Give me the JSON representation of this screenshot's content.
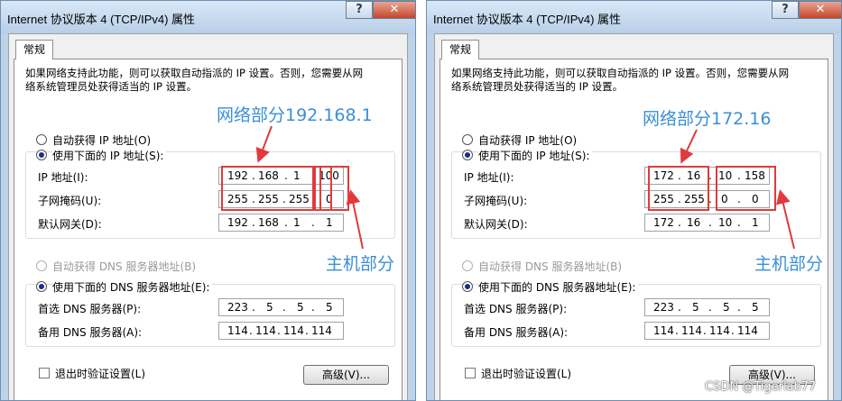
{
  "windows": [
    {
      "title": "Internet 协议版本 4 (TCP/IPv4) 属性",
      "help_label": "?",
      "close_label": "✕",
      "tab": "常规",
      "description": "如果网络支持此功能，则可以获取自动指派的 IP 设置。否则，您需要从网络系统管理员处获得适当的 IP 设置。",
      "auto_ip_label": "自动获得 IP 地址(O)",
      "manual_ip_label": "使用下面的 IP 地址(S):",
      "ip_label": "IP 地址(I):",
      "mask_label": "子网掩码(U):",
      "gateway_label": "默认网关(D):",
      "ip": [
        "192",
        "168",
        "1",
        "100"
      ],
      "mask": [
        "255",
        "255",
        "255",
        "0"
      ],
      "gateway": [
        "192",
        "168",
        "1",
        "1"
      ],
      "auto_dns_label": "自动获得 DNS 服务器地址(B)",
      "manual_dns_label": "使用下面的 DNS 服务器地址(E):",
      "dns1_label": "首选 DNS 服务器(P):",
      "dns2_label": "备用 DNS 服务器(A):",
      "dns1": [
        "223",
        "5",
        "5",
        "5"
      ],
      "dns2": [
        "114",
        "114",
        "114",
        "114"
      ],
      "validate_label": "退出时验证设置(L)",
      "advanced_label": "高级(V)...",
      "network_annotation": "网络部分192.168.1",
      "host_annotation": "主机部分"
    },
    {
      "title": "Internet 协议版本 4 (TCP/IPv4) 属性",
      "help_label": "?",
      "close_label": "✕",
      "tab": "常规",
      "description": "如果网络支持此功能，则可以获取自动指派的 IP 设置。否则，您需要从网络系统管理员处获得适当的 IP 设置。",
      "auto_ip_label": "自动获得 IP 地址(O)",
      "manual_ip_label": "使用下面的 IP 地址(S):",
      "ip_label": "IP 地址(I):",
      "mask_label": "子网掩码(U):",
      "gateway_label": "默认网关(D):",
      "ip": [
        "172",
        "16",
        "10",
        "158"
      ],
      "mask": [
        "255",
        "255",
        "0",
        "0"
      ],
      "gateway": [
        "172",
        "16",
        "10",
        "1"
      ],
      "auto_dns_label": "自动获得 DNS 服务器地址(B)",
      "manual_dns_label": "使用下面的 DNS 服务器地址(E):",
      "dns1_label": "首选 DNS 服务器(P):",
      "dns2_label": "备用 DNS 服务器(A):",
      "dns1": [
        "223",
        "5",
        "5",
        "5"
      ],
      "dns2": [
        "114",
        "114",
        "114",
        "114"
      ],
      "validate_label": "退出时验证设置(L)",
      "advanced_label": "高级(V)...",
      "network_annotation": "网络部分172.16",
      "host_annotation": "主机部分"
    }
  ],
  "watermark": "CSDN @Tigerlab77",
  "colors": {
    "annotation_blue": "#3b8fd6",
    "highlight_red": "#e23a3a",
    "window_frame": "#bcd3ea",
    "close_button": "#c7462e",
    "selected_radio": "#1a2d8a"
  }
}
